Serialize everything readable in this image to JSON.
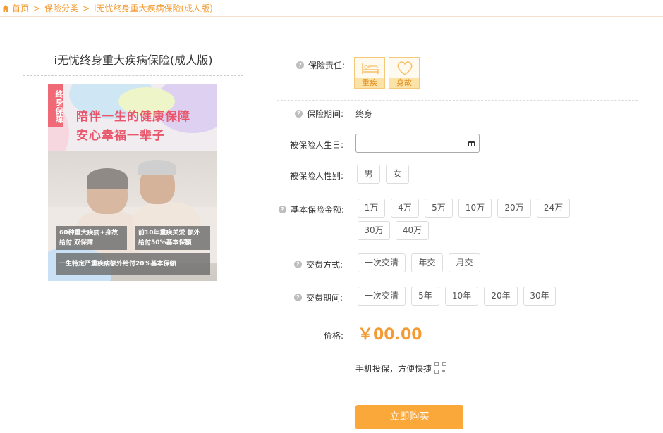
{
  "breadcrumb": {
    "home": "首页",
    "category": "保险分类",
    "current": "i无忧终身重大疾病保险(成人版)",
    "separator": ">"
  },
  "product": {
    "title": "i无忧终身重大疾病保险(成人版)",
    "banner": {
      "tag": "终身保障",
      "headline_line1": "陪伴一生的健康保障",
      "headline_line2": "安心幸福一辈子",
      "caption1_line1": "60种重大疾病+身故",
      "caption1_line2": "给付 双保障",
      "caption2_line1": "前10年重疾关爱  额外",
      "caption2_line2": "给付50%基本保额",
      "caption3": "一生特定严重疾病额外给付20%基本保额"
    }
  },
  "form": {
    "responsibility": {
      "label": "保险责任:",
      "items": [
        {
          "label": "重疾",
          "icon": "bed-icon"
        },
        {
          "label": "身故",
          "icon": "heart-icon"
        }
      ]
    },
    "period": {
      "label": "保险期间:",
      "value": "终身"
    },
    "birthday": {
      "label": "被保险人生日:",
      "value": ""
    },
    "gender": {
      "label": "被保险人性别:",
      "options": [
        "男",
        "女"
      ]
    },
    "amount": {
      "label": "基本保险金额:",
      "options": [
        "1万",
        "4万",
        "5万",
        "10万",
        "20万",
        "24万",
        "30万",
        "40万"
      ]
    },
    "pay_method": {
      "label": "交费方式:",
      "options": [
        "一次交清",
        "年交",
        "月交"
      ]
    },
    "pay_period": {
      "label": "交费期间:",
      "options": [
        "一次交清",
        "5年",
        "10年",
        "20年",
        "30年"
      ]
    },
    "price": {
      "label": "价格:",
      "value": "￥00.00"
    },
    "mobile_text": "手机投保，方便快捷",
    "buy_label": "立即购买"
  },
  "colors": {
    "accent": "#f39c35",
    "button": "#fba83a",
    "tag": "#ef6a76"
  }
}
